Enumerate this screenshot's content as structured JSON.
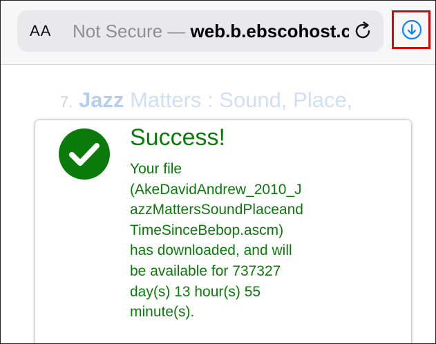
{
  "browser": {
    "aa_label": "AA",
    "url_security": "Not Secure — ",
    "url_host": "web.b.ebscohost.com",
    "reload_icon": "reload-icon",
    "download_icon": "download-icon",
    "highlight_color": "#e00000",
    "accent_color": "#0a84ff"
  },
  "content": {
    "item_number": "7.",
    "title_bold": "Jazz",
    "title_rest": " Matters : Sound, Place,"
  },
  "dialog": {
    "icon": "checkmark-icon",
    "title": "Success!",
    "color": "#0a7a0a",
    "message_lines": [
      "Your file",
      "(AkeDavidAndrew_2010_J",
      "azzMattersSoundPlaceand",
      "TimeSinceBebop.ascm)",
      "has downloaded, and will",
      "be available for 737327",
      "day(s) 13 hour(s) 55",
      "minute(s)."
    ]
  }
}
